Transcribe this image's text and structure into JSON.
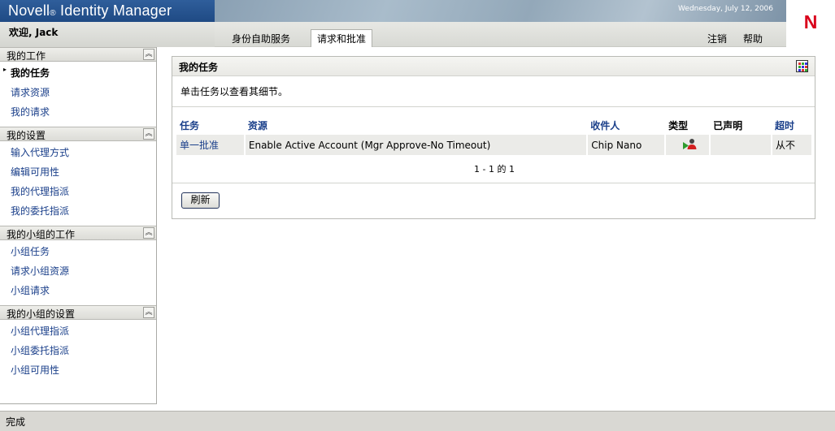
{
  "header": {
    "brand": "Novell",
    "brand_mark": "®",
    "product": " Identity Manager",
    "date": "Wednesday, July 12, 2006",
    "welcome": "欢迎, Jack",
    "tabs": [
      {
        "label": "身份自助服务"
      },
      {
        "label": "请求和批准"
      }
    ],
    "logout": "注销",
    "help": "帮助",
    "corner_logo": "N"
  },
  "sidebar": {
    "sections": [
      {
        "title": "我的工作",
        "items": [
          "我的任务",
          "请求资源",
          "我的请求"
        ]
      },
      {
        "title": "我的设置",
        "items": [
          "输入代理方式",
          "编辑可用性",
          "我的代理指派",
          "我的委托指派"
        ]
      },
      {
        "title": "我的小组的工作",
        "items": [
          "小组任务",
          "请求小组资源",
          "小组请求"
        ]
      },
      {
        "title": "我的小组的设置",
        "items": [
          "小组代理指派",
          "小组委托指派",
          "小组可用性"
        ]
      }
    ],
    "collapse_glyph": "︽"
  },
  "panel": {
    "title": "我的任务",
    "description": "单击任务以查看其细节。",
    "columns": [
      "任务",
      "资源",
      "收件人",
      "类型",
      "已声明",
      "超时"
    ],
    "rows": [
      {
        "task": "单一批准",
        "resource": "Enable Active Account (Mgr Approve-No Timeout)",
        "recipient": "Chip Nano",
        "type_icon": "approval-user-icon",
        "claimed": "",
        "timeout": "从不"
      }
    ],
    "pager": "1 - 1 的 1",
    "refresh": "刷新"
  },
  "status": {
    "text": "完成"
  },
  "colors": {
    "link": "#1a3f8a",
    "brand_band": "#2f5e9b",
    "novell_red": "#d9001b"
  }
}
